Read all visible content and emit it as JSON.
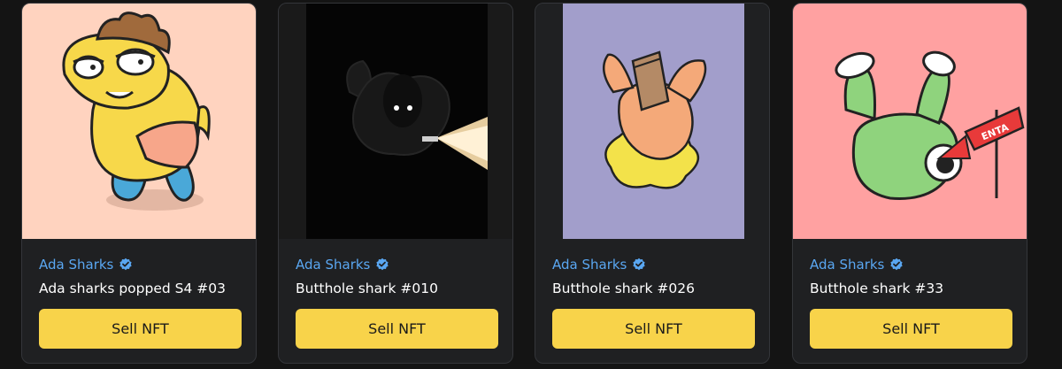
{
  "cards": [
    {
      "collection": "Ada Sharks",
      "name": "Ada sharks popped S4 #03",
      "sell_label": "Sell NFT",
      "art_background": "#ffd3bf"
    },
    {
      "collection": "Ada Sharks",
      "name": "Butthole shark #010",
      "sell_label": "Sell NFT",
      "art_background": "#050505"
    },
    {
      "collection": "Ada Sharks",
      "name": "Butthole shark #026",
      "sell_label": "Sell NFT",
      "art_background": "#a29ecb"
    },
    {
      "collection": "Ada Sharks",
      "name": "Butthole shark #33",
      "sell_label": "Sell NFT",
      "art_background": "#ffa1a1",
      "art_sign_text": "ENTA"
    }
  ],
  "colors": {
    "page_background": "#141414",
    "card_background": "#1f2022",
    "accent_blue": "#5aa7f2",
    "button_yellow": "#f8d34a"
  },
  "icons": {
    "verified": "verified-badge-icon"
  }
}
